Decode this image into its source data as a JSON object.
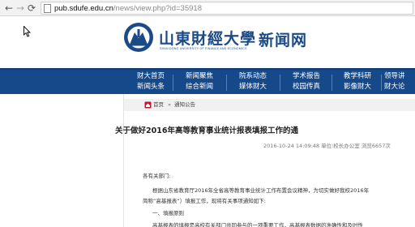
{
  "browser": {
    "url_domain": "pub.sdufe.edu.cn",
    "url_path": "/news/view.php?id=35918"
  },
  "header": {
    "logo_cn": "山東財經大學",
    "logo_en": "SHAN DONG UNIVERSITY OF FINANCE AND ECONOMICS",
    "site_name": "新闻网"
  },
  "nav": {
    "columns": [
      [
        "财大首页",
        "新闻头条"
      ],
      [
        "新闻聚焦",
        "综合新闻"
      ],
      [
        "院系动态",
        "媒体财大"
      ],
      [
        "学术报告",
        "校园传真"
      ],
      [
        "教学科研",
        "影像财大"
      ],
      [
        "领导讲",
        "财大论"
      ]
    ]
  },
  "breadcrumb": {
    "home": "首页",
    "separator": "»",
    "section": "通知公告"
  },
  "article": {
    "title": "关于做好2016年高等教育事业统计报表填报工作的通",
    "meta": "2016-10-24 14:09:48  单位:校长办公室  浏览6657次",
    "salutation": "各有关部门:",
    "line1": "根据山东省教育厅2016年全省高等教育事业统计工作布置会议精神，为切实做好我校2016年",
    "line2": "简称“高基报表”）填报工作，现将有关事项通知如下:",
    "line3": "一、填报原则",
    "line4": "高基报表的填报是高校有关部门共同参与的一项重要工作，高基报表数据的准确性和及时性"
  },
  "colors": {
    "nav_bg": "#16498a",
    "logo_blue": "#1c4a86",
    "crumb_bg": "#f1f1f1"
  }
}
